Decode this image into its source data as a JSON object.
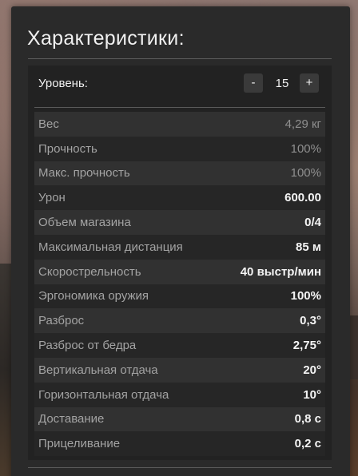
{
  "panel": {
    "title": "Характеристики:"
  },
  "level": {
    "label": "Уровень:",
    "minus": "-",
    "value": "15",
    "plus": "+"
  },
  "stats": [
    {
      "label": "Вес",
      "value": "4,29 кг",
      "muted": true
    },
    {
      "label": "Прочность",
      "value": "100%",
      "muted": true
    },
    {
      "label": "Макс. прочность",
      "value": "100%",
      "muted": true
    },
    {
      "label": "Урон",
      "value": "600.00",
      "muted": false
    },
    {
      "label": "Объем магазина",
      "value": "0/4",
      "muted": false
    },
    {
      "label": "Максимальная дистанция",
      "value": "85 м",
      "muted": false
    },
    {
      "label": "Скорострельность",
      "value": "40 выстр/мин",
      "muted": false
    },
    {
      "label": "Эргономика оружия",
      "value": "100%",
      "muted": false
    },
    {
      "label": "Разброс",
      "value": "0,3°",
      "muted": false
    },
    {
      "label": "Разброс от бедра",
      "value": "2,75°",
      "muted": false
    },
    {
      "label": "Вертикальная отдача",
      "value": "20°",
      "muted": false
    },
    {
      "label": "Горизонтальная отдача",
      "value": "10°",
      "muted": false
    },
    {
      "label": "Доставание",
      "value": "0,8 с",
      "muted": false
    },
    {
      "label": "Прицеливание",
      "value": "0,2 с",
      "muted": false
    }
  ],
  "colors": {
    "panel_bg": "#2a2a2a",
    "stats_bg": "#222222",
    "row_odd": "#313131",
    "row_even": "#262626",
    "label_text": "#a3a3a3",
    "value_text": "#f4f4f4"
  }
}
